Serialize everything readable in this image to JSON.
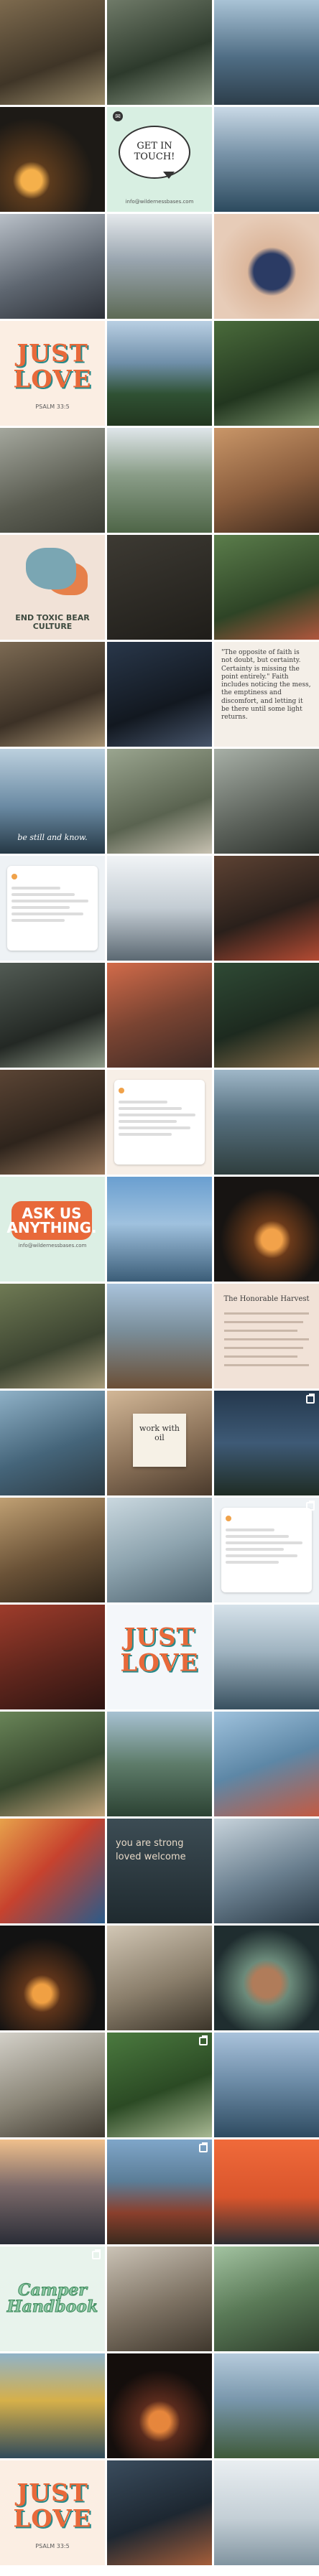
{
  "colors": {
    "accent_orange": "#e8693a",
    "mint": "#d8efe2",
    "peach": "#f1e2d7"
  },
  "text_tiles": {
    "get_in_touch": {
      "title": "GET IN TOUCH!",
      "email": "info@wildernessbases.com"
    },
    "just_love_1": {
      "title": "JUST LOVE",
      "sub": "PSALM 33:5"
    },
    "end_toxic": {
      "title": "END TOXIC BEAR CULTURE"
    },
    "be_still": {
      "title": "be still and know."
    },
    "quote_faith": {
      "title": "\"The opposite of faith is not doubt, but certainty. Certainty is missing the point entirely.\" Faith includes noticing the mess, the emptiness and discomfort, and letting it be there until some light returns."
    },
    "ask_us": {
      "title": "ASK US ANYTHING.",
      "sub": "info@wildernessbases.com"
    },
    "honorable": {
      "title": "The Honorable Harvest"
    },
    "work_oil": {
      "title": "work with oil"
    },
    "just_love_2": {
      "title": "JUST LOVE"
    },
    "you_are": {
      "title": "you are strong loved welcome"
    },
    "camper_handbook": {
      "title": "Camper Handbook"
    },
    "just_love_3": {
      "title": "JUST LOVE",
      "sub": "PSALM 33:5"
    }
  },
  "tiles": [
    {
      "name": "post-photo-portage",
      "bg": "linear-gradient(160deg,#7d6a4e,#3f3527 60%,#9a8b6a)"
    },
    {
      "name": "post-photo-turtle",
      "bg": "linear-gradient(160deg,#6f7a68,#2d3a2c 55%,#8e9b86)"
    },
    {
      "name": "post-photo-canoe-lake",
      "bg": "linear-gradient(180deg,#a9c3d6,#4f6d84 55%,#2d3e4b)"
    },
    {
      "name": "post-photo-campfire",
      "bg": "radial-gradient(circle at 30% 70%,#f5b04b 0 10%,#5c3b1d 18%,#1d1a16 60%)"
    },
    {
      "name": "post-get-in-touch",
      "bg": "#d8efe2",
      "text": "get_in_touch"
    },
    {
      "name": "post-photo-paddler-lake",
      "bg": "linear-gradient(180deg,#c9d9e6,#7893a8 45%,#2c4a5e)"
    },
    {
      "name": "post-photo-group-hands",
      "bg": "linear-gradient(160deg,#b9c0c8,#5e6670 55%,#2c3037)"
    },
    {
      "name": "post-photo-kids-canoe",
      "bg": "linear-gradient(180deg,#e5e9ec,#98a4ae 45%,#5d6a55)"
    },
    {
      "name": "post-photo-blueberries",
      "bg": "radial-gradient(circle at 55% 55%,#2b3b64 0 22%,#dcb79c 30%,#e7ccb8 70%)"
    },
    {
      "name": "post-just-love",
      "bg": "#fbeee3",
      "text": "just_love_1"
    },
    {
      "name": "post-photo-lake-forest",
      "bg": "linear-gradient(180deg,#b9cfe3,#6f8fa9 40%,#2f5133 70%,#22361f)"
    },
    {
      "name": "post-photo-sign",
      "bg": "linear-gradient(160deg,#4a6b3b,#22361f 60%,#78906a)"
    },
    {
      "name": "post-photo-woman-book",
      "bg": "linear-gradient(160deg,#a4a79d,#5b5d52 60%,#3b3d35)"
    },
    {
      "name": "post-photo-canoes-river",
      "bg": "linear-gradient(180deg,#dfe6ea,#8a9d88 45%,#4e6547)"
    },
    {
      "name": "post-photo-rack",
      "bg": "linear-gradient(160deg,#c99668,#8a5d3d 55%,#3e2a1d)"
    },
    {
      "name": "post-end-toxic",
      "bg": "#f1e2d7",
      "text": "end_toxic"
    },
    {
      "name": "post-photo-dark-quote",
      "bg": "linear-gradient(160deg,#3d3a33,#1f1d19)"
    },
    {
      "name": "post-photo-hat",
      "bg": "linear-gradient(160deg,#5b7d4b,#2e4426 60%,#b0563d)"
    },
    {
      "name": "post-photo-cabin-porch",
      "bg": "linear-gradient(160deg,#7c6a53,#3c3126 60%,#a99474)"
    },
    {
      "name": "post-photo-backpack",
      "bg": "linear-gradient(160deg,#29374a,#121820 60%,#47556b)"
    },
    {
      "name": "post-quote-faith",
      "bg": "#f4efe8",
      "text": "quote_faith"
    },
    {
      "name": "post-be-still",
      "bg": "linear-gradient(180deg,#bcd0de,#6a8aa3 55%,#253845)",
      "text": "be_still"
    },
    {
      "name": "post-photo-group-rocks",
      "bg": "linear-gradient(160deg,#9aa58f,#5a6350 60%,#c7c1b1)"
    },
    {
      "name": "post-photo-pack-boat",
      "bg": "linear-gradient(160deg,#a7afa6,#5b615a 60%,#2c312c)"
    },
    {
      "name": "post-graphic-card-1",
      "bg": "#eef2f5",
      "text": "card"
    },
    {
      "name": "post-photo-snow",
      "bg": "linear-gradient(180deg,#f1f4f6,#c3ccd3 50%,#5b6872)"
    },
    {
      "name": "post-photo-paddler-red",
      "bg": "linear-gradient(160deg,#5d4233,#2a201b 55%,#b44b33)"
    },
    {
      "name": "post-photo-leaf-wood",
      "bg": "linear-gradient(160deg,#525b54,#232824 60%,#8f9a88)"
    },
    {
      "name": "post-photo-camper-kid",
      "bg": "linear-gradient(160deg,#d26b4a,#7a4432 50%,#3d2a25)"
    },
    {
      "name": "post-photo-chalkboard",
      "bg": "linear-gradient(160deg,#2f4a35,#1d2a1f 55%,#8a6e4b)"
    },
    {
      "name": "post-photo-dinner",
      "bg": "linear-gradient(160deg,#5a4434,#2e241c 55%,#9b7a5d)"
    },
    {
      "name": "post-graphic-card-2",
      "bg": "#f7efe7",
      "text": "card"
    },
    {
      "name": "post-photo-dock",
      "bg": "linear-gradient(180deg,#9fb7c8,#56707f 45%,#2f3e3e)"
    },
    {
      "name": "post-ask-us",
      "bg": "#dcefe4",
      "text": "ask_us"
    },
    {
      "name": "post-photo-lake-sky",
      "bg": "linear-gradient(180deg,#6a9fd0,#9fc1de 45%,#3b5d78)"
    },
    {
      "name": "post-photo-fire-night",
      "bg": "radial-gradient(circle at 55% 60%,#f2a24a 0 12%,#6b3a1a 22%,#171412 60%)"
    },
    {
      "name": "post-photo-hikers",
      "bg": "linear-gradient(160deg,#6f7a54,#3b4330 60%,#a89b7a)"
    },
    {
      "name": "post-photo-cabin",
      "bg": "linear-gradient(180deg,#a9c3dc,#7a8e9a 45%,#6b4f36)"
    },
    {
      "name": "post-honorable-harvest",
      "bg": "#f1e2d7",
      "text": "honorable"
    },
    {
      "name": "post-photo-portrait",
      "bg": "linear-gradient(160deg,#8fb1c7,#45657a 55%,#2c3b44)"
    },
    {
      "name": "post-work-oil",
      "bg": "linear-gradient(160deg,#d2b797,#8b7259 55%,#4a3a2c)",
      "text": "work_oil"
    },
    {
      "name": "post-photo-sky",
      "bg": "linear-gradient(180deg,#24384d,#3e5a76 50%,#1f2c24)"
    },
    {
      "name": "post-photo-paddle-group",
      "bg": "linear-gradient(160deg,#c0a073,#6a5237 55%,#2e2419)"
    },
    {
      "name": "post-photo-canoes-overhead",
      "bg": "linear-gradient(160deg,#cad8df,#8ea4af 50%,#4f6470)"
    },
    {
      "name": "post-graphic-card-3",
      "bg": "#eef2f5",
      "text": "card"
    },
    {
      "name": "post-photo-papers",
      "bg": "linear-gradient(160deg,#9e3c2b,#5d251c 55%,#2c1411)"
    },
    {
      "name": "post-just-love-2",
      "bg": "#f4f7fa",
      "text": "just_love_2"
    },
    {
      "name": "post-photo-lake-calm",
      "bg": "linear-gradient(180deg,#d6e2ea,#9fb3c0 45%,#38505f)"
    },
    {
      "name": "post-photo-picnic",
      "bg": "linear-gradient(160deg,#698558,#35452c 55%,#c3a57c)"
    },
    {
      "name": "post-photo-paddle-reeds",
      "bg": "linear-gradient(180deg,#a7c1d2,#5e7c6a 50%,#2c4233)"
    },
    {
      "name": "post-photo-selfie",
      "bg": "linear-gradient(160deg,#9fc2dd,#5d87a6 50%,#c45a42)"
    },
    {
      "name": "post-photo-abstract",
      "bg": "linear-gradient(135deg,#e7a24b,#c7422e 45%,#2a5b8a)"
    },
    {
      "name": "post-you-are",
      "bg": "linear-gradient(180deg,#3c4c54,#1f2a2f)",
      "text": "you_are"
    },
    {
      "name": "post-photo-backpack-2",
      "bg": "linear-gradient(160deg,#c7d3db,#6a7f8f 55%,#2b3b47)"
    },
    {
      "name": "post-photo-fire-dark",
      "bg": "radial-gradient(circle at 40% 65%,#f0a043 0 10%,#5e341a 20%,#121212 60%)"
    },
    {
      "name": "post-photo-tent-sign",
      "bg": "linear-gradient(160deg,#d2c7b5,#8a7e6b 55%,#3c352a)"
    },
    {
      "name": "post-photo-table-circle",
      "bg": "radial-gradient(circle at 50% 55%,#b07c5a 0 18%,#6b8a7a 30%,#1f2d2f 70%)"
    },
    {
      "name": "post-photo-hand-rope",
      "bg": "linear-gradient(160deg,#d3d0c8,#8b8678 55%,#3f3a31)"
    },
    {
      "name": "post-photo-green-pack",
      "bg": "linear-gradient(160deg,#4b7a3f,#2b4a24 55%,#a8b893)"
    },
    {
      "name": "post-photo-bow-lake",
      "bg": "linear-gradient(180deg,#a9c2db,#6f8ea9 45%,#2e4b61)"
    },
    {
      "name": "post-photo-sunset-lake",
      "bg": "linear-gradient(180deg,#f0c08c,#7c6a6a 45%,#2a2d37)"
    },
    {
      "name": "post-photo-red-cabin",
      "bg": "linear-gradient(180deg,#7fa6c9,#5b7d97 40%,#8a3f2c 70%,#3b2a1e)"
    },
    {
      "name": "post-photo-ing-sign",
      "bg": "linear-gradient(180deg,#f06a3a,#d9552c 55%,#2e2f33)"
    },
    {
      "name": "post-camper-handbook",
      "bg": "#e8f3ec",
      "text": "camper_handbook"
    },
    {
      "name": "post-photo-door",
      "bg": "linear-gradient(160deg,#cbc3b6,#7d7263 55%,#3f372d)"
    },
    {
      "name": "post-photo-chapel",
      "bg": "linear-gradient(160deg,#a3c3a1,#5a7a57 50%,#2d3d2b)"
    },
    {
      "name": "post-photo-life-jacket",
      "bg": "linear-gradient(180deg,#8fb2c8,#d6b04a 45%,#2f4a5b)"
    },
    {
      "name": "post-photo-candles",
      "bg": "radial-gradient(circle at 50% 65%,#e6863c 0 12%,#5a2b1d 24%,#140e0c 60%)"
    },
    {
      "name": "post-photo-canoe-shore",
      "bg": "linear-gradient(180deg,#b6cbdc,#7896ab 45%,#3f5a3a)"
    },
    {
      "name": "post-just-love-3",
      "bg": "#fbeee3",
      "text": "just_love_3"
    },
    {
      "name": "post-photo-bookshelf",
      "bg": "linear-gradient(160deg,#3a4c5d,#1d2731 55%,#a55e3a)"
    },
    {
      "name": "post-photo-mist",
      "bg": "linear-gradient(180deg,#e9eef1,#c4cfd6 55%,#8194a0)"
    }
  ]
}
